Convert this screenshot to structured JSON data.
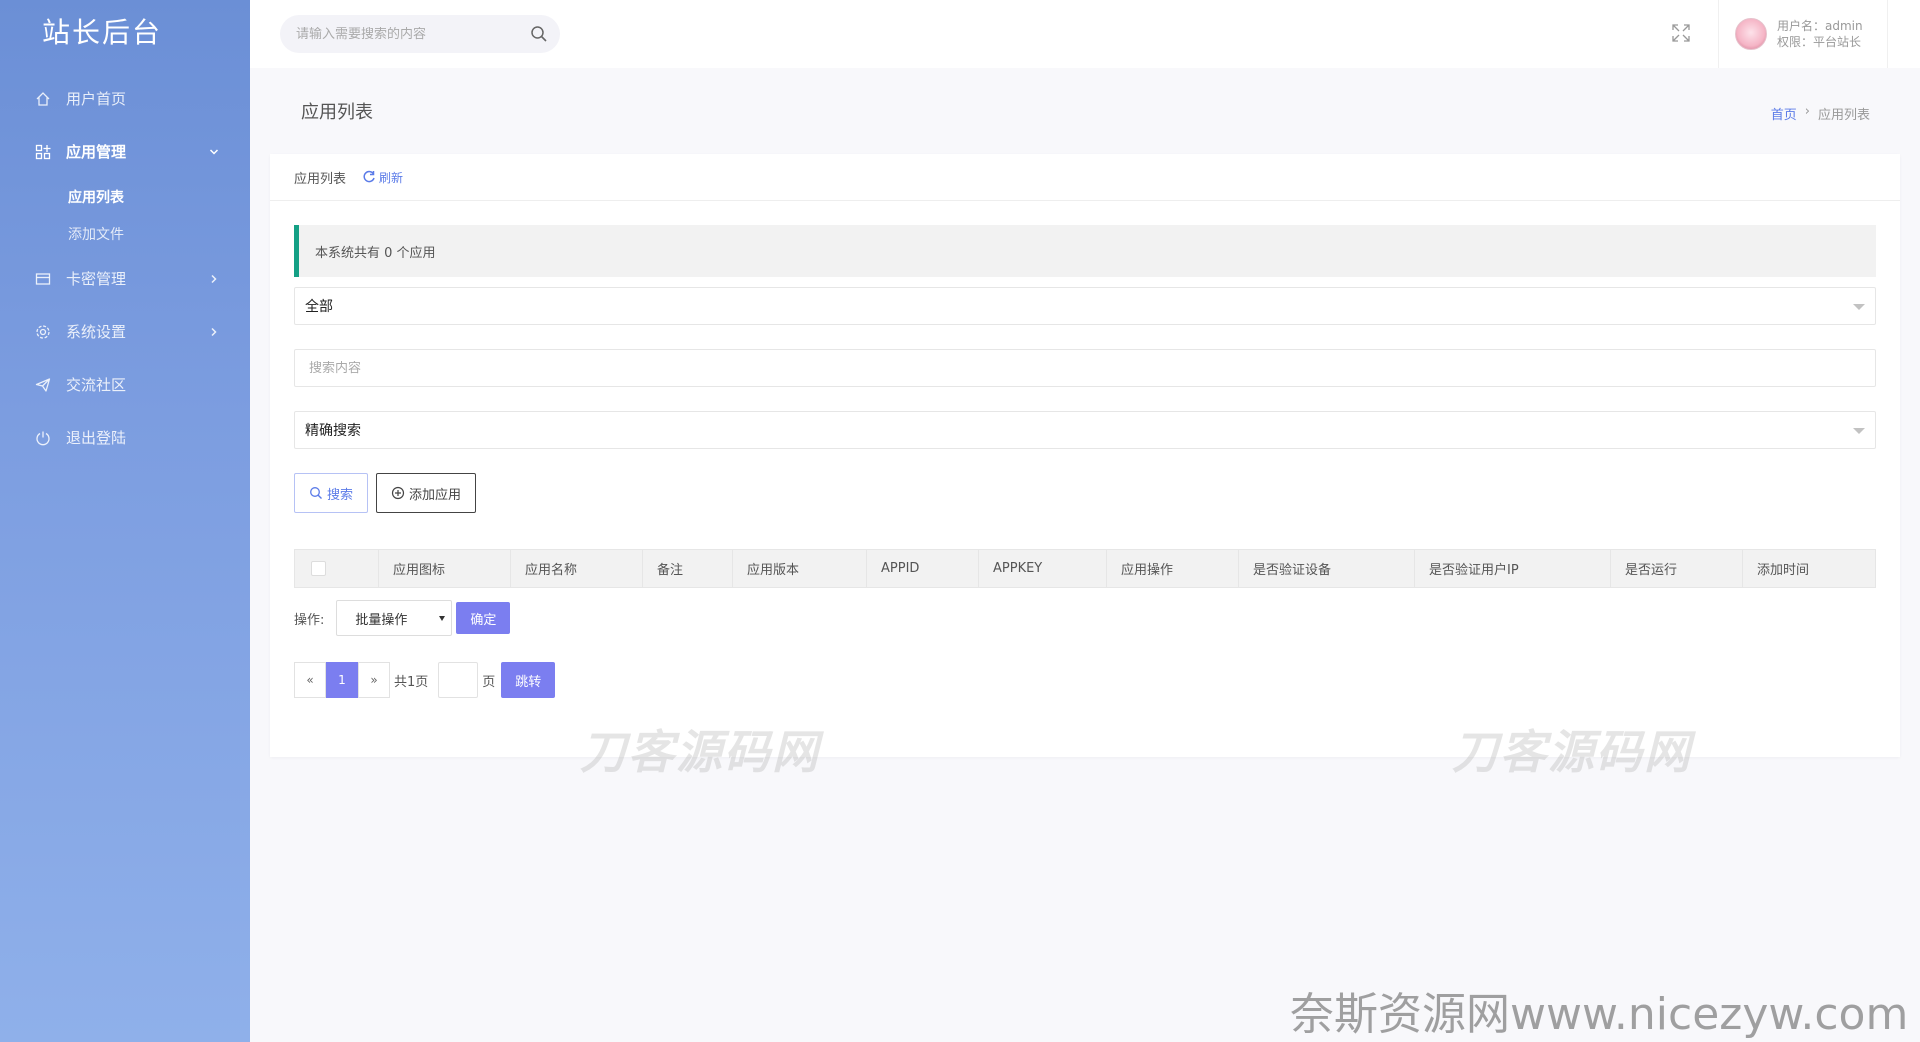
{
  "sidebar": {
    "brand": "站长后台",
    "items": [
      {
        "label": "用户首页"
      },
      {
        "label": "应用管理"
      },
      {
        "label": "卡密管理"
      },
      {
        "label": "系统设置"
      },
      {
        "label": "交流社区"
      },
      {
        "label": "退出登陆"
      }
    ],
    "subitems": [
      {
        "label": "应用列表"
      },
      {
        "label": "添加文件"
      }
    ]
  },
  "header": {
    "search_placeholder": "请输入需要搜索的内容",
    "user_name": "用户名：admin",
    "user_role": "权限：平台站长"
  },
  "page": {
    "title": "应用列表",
    "breadcrumb_home": "首页",
    "breadcrumb_sep": "›",
    "breadcrumb_current": "应用列表"
  },
  "card": {
    "head_title": "应用列表",
    "refresh_label": "刷新",
    "notice": "本系统共有 0 个应用",
    "filter_select_value": "全部",
    "search_placeholder": "搜索内容",
    "mode_select_value": "精确搜索",
    "search_button": "搜索",
    "add_button": "添加应用"
  },
  "table": {
    "columns": [
      "应用图标",
      "应用名称",
      "备注",
      "应用版本",
      "APPID",
      "APPKEY",
      "应用操作",
      "是否验证设备",
      "是否验证用户IP",
      "是否运行",
      "添加时间"
    ]
  },
  "ops": {
    "label": "操作:",
    "select_value": "批量操作",
    "confirm": "确定"
  },
  "pager": {
    "prev": "«",
    "current": "1",
    "next": "»",
    "total": "共1页",
    "unit": "页",
    "jump": "跳转"
  },
  "watermarks": {
    "card_text": "刀客源码网",
    "corner_text": "奈斯资源网www.nicezyw.com"
  },
  "colors": {
    "accent": "#7b7ef0",
    "link": "#5b7be8",
    "notice_border": "#14a085",
    "sidebar_top": "#6b8fd6",
    "sidebar_bottom": "#8fb0ea"
  }
}
